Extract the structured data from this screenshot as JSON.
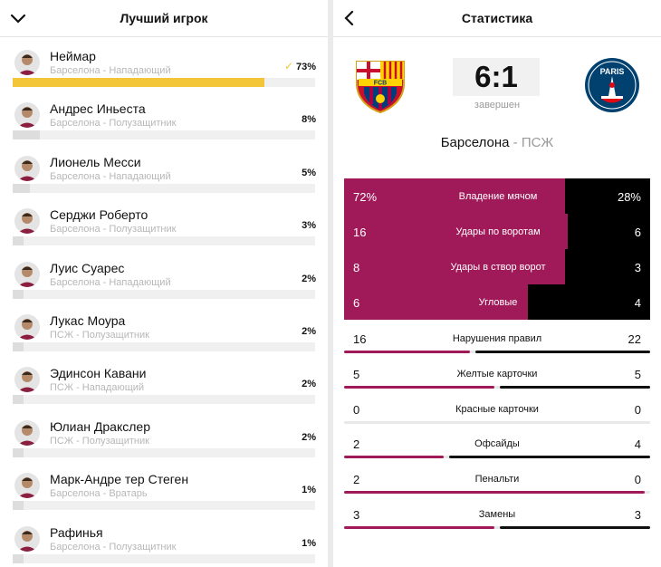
{
  "best_player": {
    "title": "Лучший игрок",
    "players": [
      {
        "name": "Неймар",
        "team_role": "Барселона - Нападающий",
        "percent_label": "73%",
        "percent": 73,
        "selected": true
      },
      {
        "name": "Андрес Иньеста",
        "team_role": "Барселона - Полузащитник",
        "percent_label": "8%",
        "percent": 8,
        "selected": false
      },
      {
        "name": "Лионель Месси",
        "team_role": "Барселона - Нападающий",
        "percent_label": "5%",
        "percent": 5,
        "selected": false
      },
      {
        "name": "Серджи Роберто",
        "team_role": "Барселона - Полузащитник",
        "percent_label": "3%",
        "percent": 3,
        "selected": false
      },
      {
        "name": "Луис Суарес",
        "team_role": "Барселона - Нападающий",
        "percent_label": "2%",
        "percent": 2,
        "selected": false
      },
      {
        "name": "Лукас Моура",
        "team_role": "ПСЖ - Полузащитник",
        "percent_label": "2%",
        "percent": 2,
        "selected": false
      },
      {
        "name": "Эдинсон Кавани",
        "team_role": "ПСЖ - Нападающий",
        "percent_label": "2%",
        "percent": 2,
        "selected": false
      },
      {
        "name": "Юлиан Дракслер",
        "team_role": "ПСЖ - Полузащитник",
        "percent_label": "2%",
        "percent": 2,
        "selected": false
      },
      {
        "name": "Марк-Андре тер Стеген",
        "team_role": "Барселона - Вратарь",
        "percent_label": "1%",
        "percent": 1,
        "selected": false
      },
      {
        "name": "Рафинья",
        "team_role": "Барселона - Полузащитник",
        "percent_label": "1%",
        "percent": 1,
        "selected": false
      }
    ]
  },
  "statistics": {
    "title": "Статистика",
    "score": "6:1",
    "status": "завершен",
    "home_team": "Барселона",
    "separator": "-",
    "away_team": "ПСЖ",
    "home_logo_text": "FCB",
    "away_logo_text": "PARIS",
    "big_stats": [
      {
        "label": "Владение мячом",
        "home": "72%",
        "away": "28%",
        "home_share": 0.72
      },
      {
        "label": "Удары по воротам",
        "home": "16",
        "away": "6",
        "home_share": 0.73
      },
      {
        "label": "Удары в створ ворот",
        "home": "8",
        "away": "3",
        "home_share": 0.72
      },
      {
        "label": "Угловые",
        "home": "6",
        "away": "4",
        "home_share": 0.6
      }
    ],
    "small_stats": [
      {
        "label": "Нарушения правил",
        "home": "16",
        "away": "22",
        "home_share": 0.42
      },
      {
        "label": "Желтые карточки",
        "home": "5",
        "away": "5",
        "home_share": 0.5
      },
      {
        "label": "Красные карточки",
        "home": "0",
        "away": "0",
        "home_share": 0
      },
      {
        "label": "Офсайды",
        "home": "2",
        "away": "4",
        "home_share": 0.33
      },
      {
        "label": "Пенальти",
        "home": "2",
        "away": "0",
        "home_share": 1
      },
      {
        "label": "Замены",
        "home": "3",
        "away": "3",
        "home_share": 0.5
      }
    ]
  },
  "colors": {
    "accent_yellow": "#f3c63a",
    "barca": "#a01a59",
    "psg": "#000000"
  }
}
